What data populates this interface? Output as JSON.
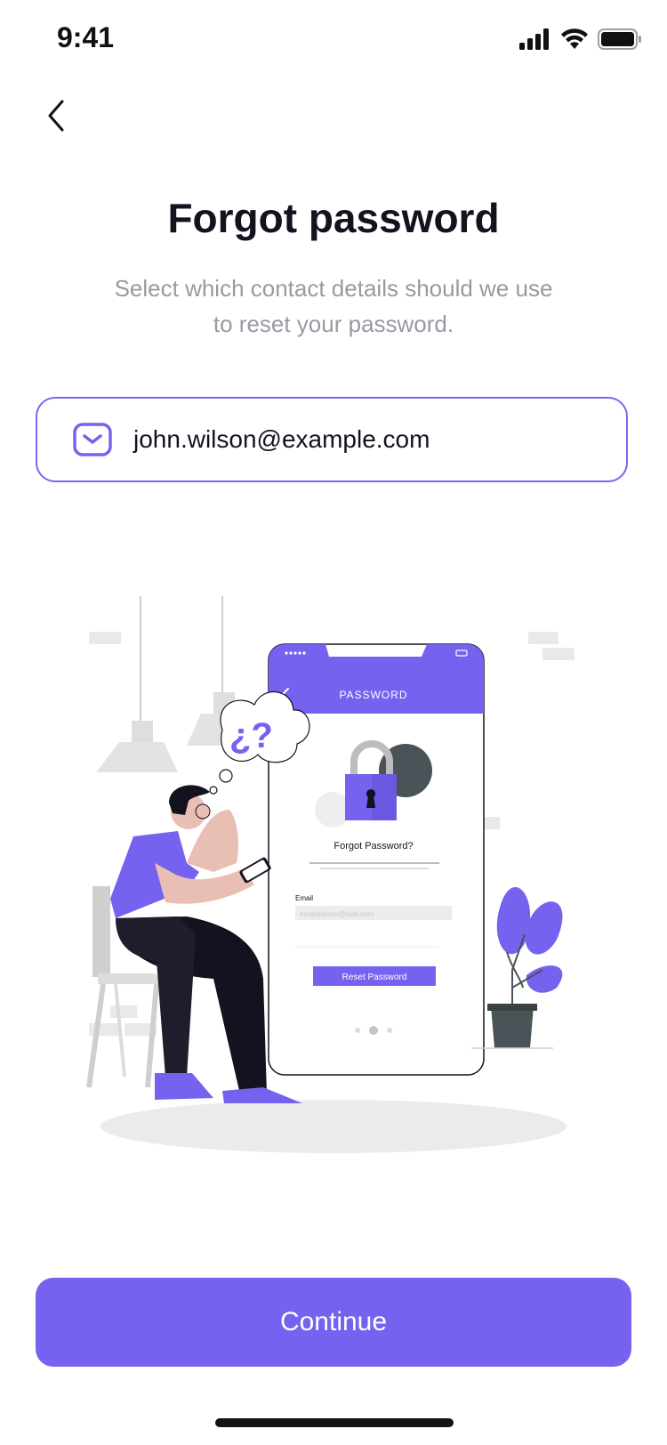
{
  "status_bar": {
    "time": "9:41"
  },
  "header": {
    "title": "Forgot password",
    "subtitle": "Select which contact details should we use to reset your password."
  },
  "contact_option": {
    "value": "john.wilson@example.com",
    "icon": "mail-icon"
  },
  "illustration": {
    "phone_header": "PASSWORD",
    "phone_heading": "Forgot Password?",
    "email_label": "Email",
    "email_placeholder": "emailadress@mail.com",
    "reset_button": "Reset Password",
    "thought": "¿?"
  },
  "footer": {
    "continue_label": "Continue"
  },
  "colors": {
    "accent": "#7563ef",
    "title": "#14121f",
    "subtitle": "#9a99a3"
  }
}
